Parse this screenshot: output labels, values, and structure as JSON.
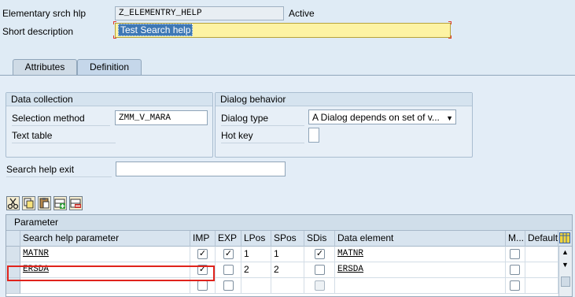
{
  "header": {
    "elem_label": "Elementary srch hlp",
    "elem_value": "Z_ELEMENTRY_HELP",
    "status": "Active",
    "shortdesc_label": "Short description",
    "shortdesc_value": "Test Search help"
  },
  "tabs": [
    {
      "label": "Attributes"
    },
    {
      "label": "Definition"
    }
  ],
  "data_collection": {
    "title": "Data collection",
    "selection_label": "Selection method",
    "selection_value": "ZMM_V_MARA",
    "text_table_label": "Text table"
  },
  "dialog": {
    "title": "Dialog behavior",
    "type_label": "Dialog type",
    "type_value": "A Dialog depends on set of v...",
    "hotkey_label": "Hot key"
  },
  "exit": {
    "label": "Search help exit"
  },
  "toolbar": {
    "icons": [
      "scissors-icon",
      "copy-icon",
      "paste-icon",
      "insert-row-icon",
      "delete-row-icon"
    ]
  },
  "param_table": {
    "title": "Parameter",
    "headers": [
      "Search help parameter",
      "IMP",
      "EXP",
      "LPos",
      "SPos",
      "SDis",
      "Data element",
      "M...",
      "Default"
    ],
    "rows": [
      {
        "param": "MATNR",
        "imp": true,
        "exp": true,
        "lpos": "1",
        "spos": "1",
        "sdis": true,
        "elem": "MATNR",
        "m": false
      },
      {
        "param": "ERSDA",
        "imp": true,
        "exp": false,
        "lpos": "2",
        "spos": "2",
        "sdis": false,
        "elem": "ERSDA",
        "m": false
      },
      {
        "param": "",
        "imp": false,
        "exp": false,
        "lpos": "",
        "spos": "",
        "sdis": false,
        "elem": "",
        "m": false
      }
    ]
  },
  "colors": {
    "background": "#dfebf5",
    "highlight_field": "#fdf3a3",
    "annotation_box": "#e0231c"
  }
}
